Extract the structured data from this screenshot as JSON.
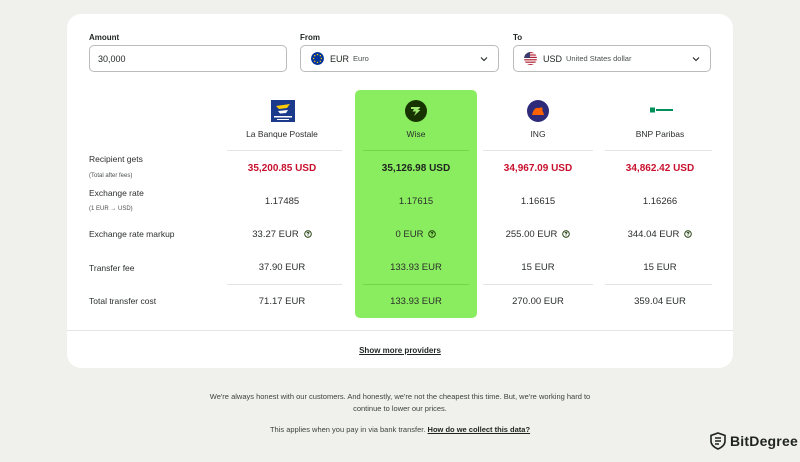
{
  "form": {
    "amount_label": "Amount",
    "amount_value": "30,000",
    "from_label": "From",
    "from_code": "EUR",
    "from_name": "Euro",
    "to_label": "To",
    "to_code": "USD",
    "to_name": "United States dollar"
  },
  "providers": [
    {
      "name": "La Banque Postale",
      "logo_text": "LA BANQUE POSTALE"
    },
    {
      "name": "Wise"
    },
    {
      "name": "ING"
    },
    {
      "name": "BNP Paribas",
      "logo_text": "BNP PARIBAS"
    }
  ],
  "rows": [
    {
      "label": "Recipient gets",
      "sublabel": "(Total after fees)",
      "values": [
        "35,200.85 USD",
        "35,126.98 USD",
        "34,967.09 USD",
        "34,862.42 USD"
      ]
    },
    {
      "label": "Exchange rate",
      "sublabel": "(1 EUR → USD)",
      "values": [
        "1.17485",
        "1.17615",
        "1.16615",
        "1.16266"
      ]
    },
    {
      "label": "Exchange rate markup",
      "values": [
        "33.27 EUR",
        "0 EUR",
        "255.00 EUR",
        "344.04 EUR"
      ]
    },
    {
      "label": "Transfer fee",
      "values": [
        "37.90 EUR",
        "133.93 EUR",
        "15 EUR",
        "15 EUR"
      ]
    },
    {
      "label": "Total transfer cost",
      "values": [
        "71.17 EUR",
        "133.93 EUR",
        "270.00 EUR",
        "359.04 EUR"
      ]
    }
  ],
  "show_more": "Show more providers",
  "footer": {
    "line1": "We're always honest with our customers. And honestly, we're not the cheapest this time. But, we're working hard to",
    "line2": "continue to lower our prices.",
    "line3": "This applies when you pay in via bank transfer.",
    "link": "How do we collect this data?"
  },
  "brand": {
    "name": "BitDegree"
  },
  "colors": {
    "wise_green": "#8aec5f",
    "red_value": "#c8102e",
    "background": "#f0f1ec"
  }
}
